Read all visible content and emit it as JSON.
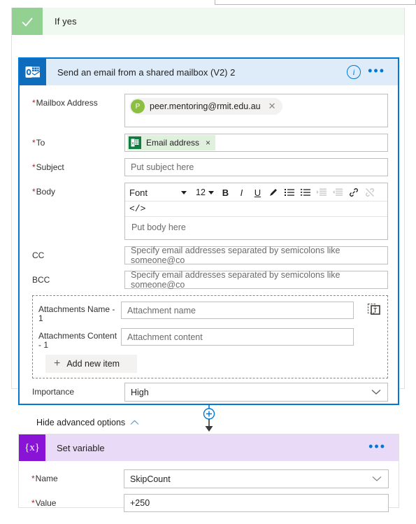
{
  "scope": {
    "title": "If yes",
    "check_icon": "checkmark-icon"
  },
  "email_card": {
    "title": "Send an email from a shared mailbox (V2) 2",
    "connector_icon": "outlook-icon",
    "info_icon": "i",
    "more_icon": "•••",
    "fields": {
      "mailbox_label": "Mailbox Address",
      "mailbox_value": "peer.mentoring@rmit.edu.au",
      "mailbox_avatar_initial": "P",
      "to_label": "To",
      "to_token": "Email address",
      "subject_label": "Subject",
      "subject_placeholder": "Put subject here",
      "body_label": "Body",
      "body_placeholder": "Put body here",
      "cc_label": "CC",
      "cc_placeholder": "Specify email addresses separated by semicolons like someone@co",
      "bcc_label": "BCC",
      "bcc_placeholder": "Specify email addresses separated by semicolons like someone@co",
      "importance_label": "Importance",
      "importance_value": "High"
    },
    "toolbar": {
      "font_name": "Font",
      "font_size": "12",
      "bold": "B",
      "italic": "I",
      "underline": "U",
      "text_color": "pen-icon",
      "bullet_list": "bulleted-list-icon",
      "number_list": "numbered-list-icon",
      "indent_increase": "indent-increase-icon",
      "indent_decrease": "indent-decrease-icon",
      "link": "link-icon",
      "unlink": "unlink-icon",
      "code_view": "</>"
    },
    "attachments": {
      "name_label": "Attachments Name - 1",
      "name_placeholder": "Attachment name",
      "content_label": "Attachments Content - 1",
      "content_placeholder": "Attachment content",
      "add_item_label": "Add new item",
      "add_item_icon": "plus-icon",
      "paste_icon": "paste-from-clipboard-icon"
    },
    "hide_advanced_label": "Hide advanced options",
    "hide_advanced_icon": "chevron-up-icon"
  },
  "connector": {
    "add_icon": "plus-circle-icon",
    "arrow_icon": "arrow-down-icon"
  },
  "variable_card": {
    "title": "Set variable",
    "icon_glyph": "{x}",
    "more_icon": "•••",
    "name_label": "Name",
    "name_value": "SkipCount",
    "value_label": "Value",
    "value_value": "+250"
  },
  "colors": {
    "accent_blue": "#0078d4",
    "scope_green": "#92d191",
    "outlook_blue": "#0f6cbd",
    "variable_purple": "#8a14d6",
    "required_red": "#a4262c"
  }
}
